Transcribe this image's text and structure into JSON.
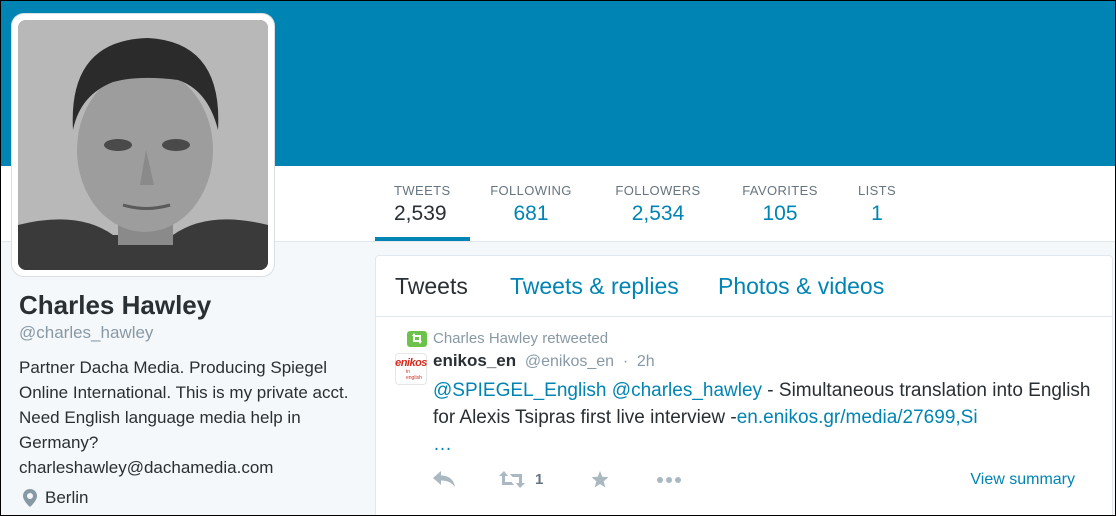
{
  "profile": {
    "name": "Charles Hawley",
    "handle": "@charles_hawley",
    "bio": "Partner Dacha Media. Producing Spiegel Online International. This is my private acct. Need English language media help in Germany?",
    "email": "charleshawley@dachamedia.com",
    "location": "Berlin"
  },
  "stats": {
    "tweets": {
      "label": "TWEETS",
      "value": "2,539"
    },
    "following": {
      "label": "FOLLOWING",
      "value": "681"
    },
    "followers": {
      "label": "FOLLOWERS",
      "value": "2,534"
    },
    "favorites": {
      "label": "FAVORITES",
      "value": "105"
    },
    "lists": {
      "label": "LISTS",
      "value": "1"
    }
  },
  "tabs": {
    "tweets": "Tweets",
    "replies": "Tweets & replies",
    "photos": "Photos & videos"
  },
  "tweet": {
    "retweet_note": "Charles Hawley retweeted",
    "avatar_logo": "enikos",
    "avatar_logo_sub": "in english",
    "author": "enikos_en",
    "author_handle": "@enikos_en",
    "separator": "·",
    "time": "2h",
    "mention1": "@SPIEGEL_English",
    "mention2": "@charles_hawley",
    "text": " - Simultaneous translation into English for Alexis Tsipras first live interview -",
    "link": "en.enikos.gr/media/27699,Si",
    "ellipsis": "…",
    "retweet_count": "1",
    "view_summary": "View summary"
  },
  "colors": {
    "banner": "#0084b4",
    "link": "#0084b4",
    "retweet_badge": "#6cc24a"
  }
}
